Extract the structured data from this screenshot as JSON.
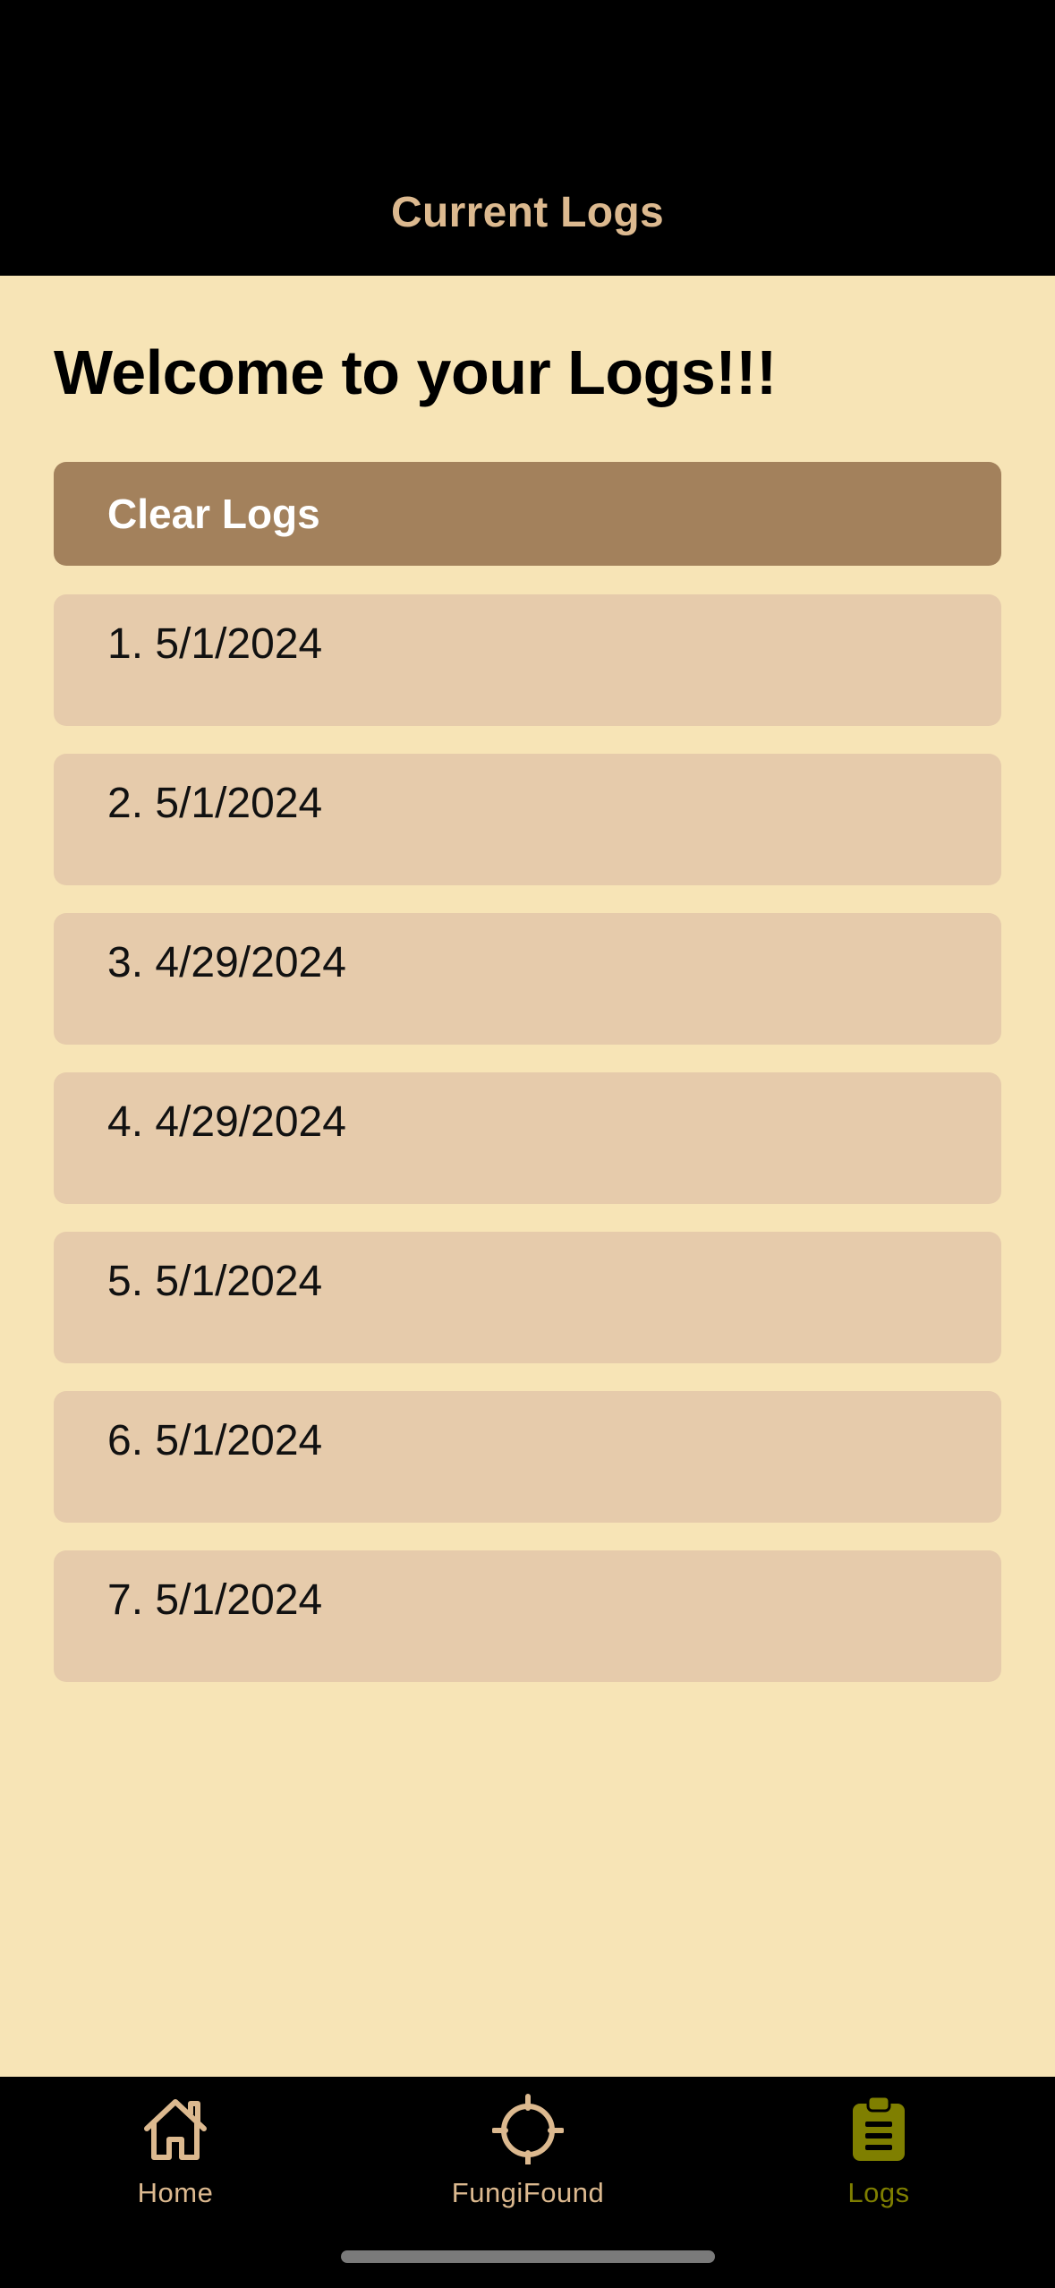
{
  "header": {
    "title": "Current Logs"
  },
  "main": {
    "welcome": "Welcome to your Logs!!!",
    "clear_button": "Clear Logs",
    "logs": [
      "1. 5/1/2024",
      "2. 5/1/2024",
      "3. 4/29/2024",
      "4. 4/29/2024",
      "5. 5/1/2024",
      "6. 5/1/2024",
      "7. 5/1/2024"
    ]
  },
  "tabs": [
    {
      "label": "Home",
      "icon": "house-icon",
      "active": false
    },
    {
      "label": "FungiFound",
      "icon": "crosshair-icon",
      "active": false
    },
    {
      "label": "Logs",
      "icon": "clipboard-icon",
      "active": true
    }
  ],
  "colors": {
    "background": "#f7e4b6",
    "header": "#000000",
    "title_accent": "#dcb98f",
    "button": "#a3815c",
    "log_item": "#e6cbab",
    "tab_inactive": "#dcb98f",
    "tab_active": "#7f7f00"
  }
}
